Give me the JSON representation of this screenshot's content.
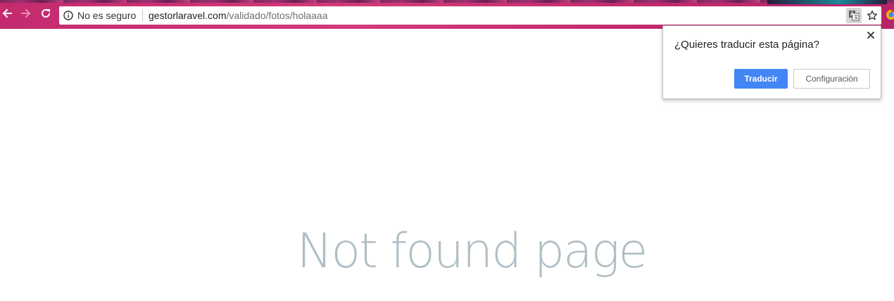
{
  "browser": {
    "security_label": "No es seguro",
    "url_host": "gestorlaravel.com",
    "url_path": "/validado/fotos/holaaaa",
    "icons": {
      "back": "back-arrow-icon",
      "forward": "forward-arrow-icon",
      "reload": "reload-icon",
      "info": "info-icon",
      "translate": "translate-icon",
      "bookmark": "star-icon"
    },
    "colors": {
      "toolbar": "#c42a6e",
      "omnibox": "#ffffff"
    }
  },
  "translate_popup": {
    "question": "¿Quieres traducir esta página?",
    "translate_label": "Traducir",
    "settings_label": "Configuración",
    "close_icon": "close-icon",
    "colors": {
      "primary_button": "#4285f4"
    }
  },
  "page": {
    "message": "Not found page",
    "colors": {
      "message": "#b0bec5"
    }
  }
}
